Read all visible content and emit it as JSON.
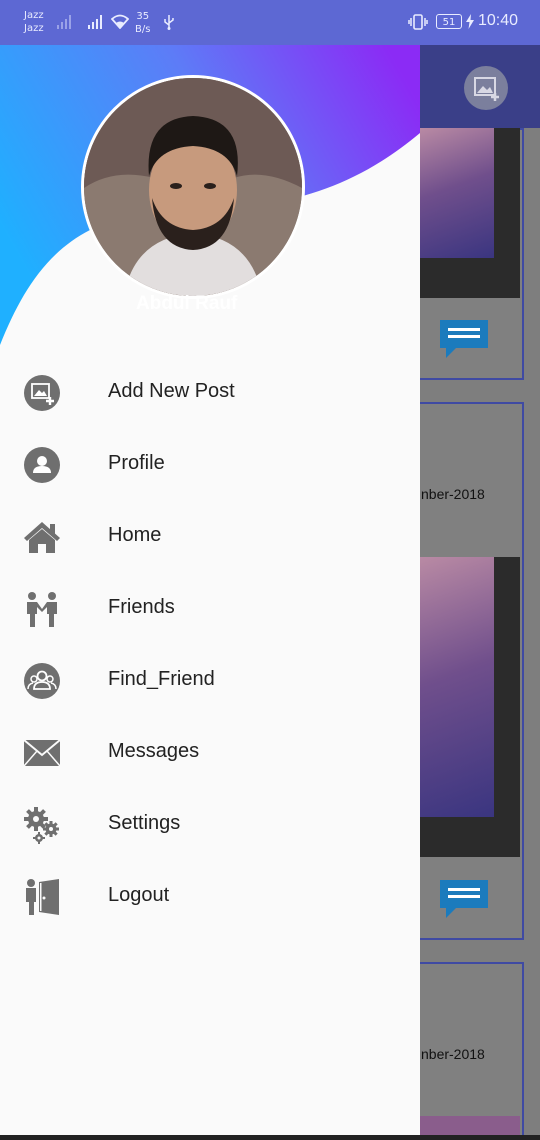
{
  "status_bar": {
    "carrier_1": "Jazz",
    "carrier_2": "Jazz",
    "net_speed_value": "35",
    "net_speed_unit": "B/s",
    "battery_level": "51",
    "time": "10:40",
    "color": "#5d68d3"
  },
  "drawer": {
    "user_name": "Abdul Rauf",
    "header_gradient": [
      "#1fb0ff",
      "#8b2bf5"
    ],
    "menu": [
      {
        "label": "Add New Post",
        "icon": "add-photo-icon"
      },
      {
        "label": "Profile",
        "icon": "profile-icon"
      },
      {
        "label": "Home",
        "icon": "home-icon"
      },
      {
        "label": "Friends",
        "icon": "friends-icon"
      },
      {
        "label": "Find_Friend",
        "icon": "find-friend-icon"
      },
      {
        "label": "Messages",
        "icon": "envelope-icon"
      },
      {
        "label": "Settings",
        "icon": "gears-icon"
      },
      {
        "label": "Logout",
        "icon": "logout-icon"
      }
    ]
  },
  "background": {
    "post_1_date": "nber-2018",
    "post_2_date": "nber-2018"
  }
}
